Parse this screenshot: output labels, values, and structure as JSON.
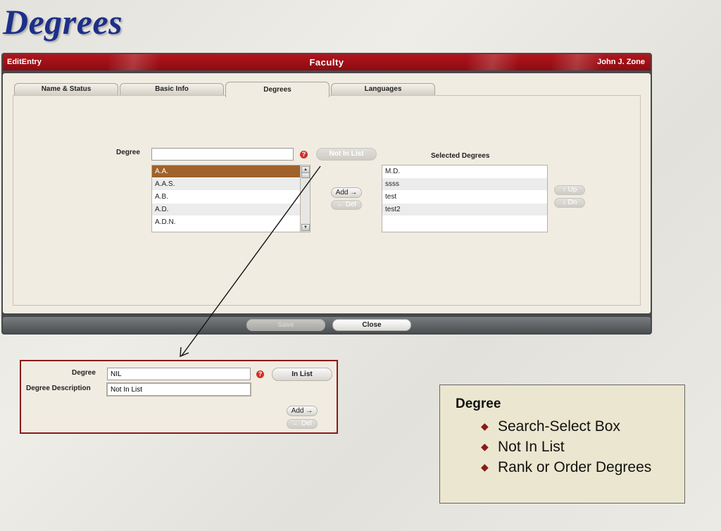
{
  "slide": {
    "title": "Degrees"
  },
  "window": {
    "left_label": "EditEntry",
    "title": "Faculty",
    "user": "John J. Zone"
  },
  "tabs": [
    {
      "label": "Name & Status"
    },
    {
      "label": "Basic Info"
    },
    {
      "label": "Degrees",
      "active": true
    },
    {
      "label": "Languages"
    }
  ],
  "degree_form": {
    "label": "Degree",
    "value": "",
    "help_icon": "?",
    "not_in_list_label": "Not In List",
    "options": [
      "A.A.",
      "A.A.S.",
      "A.B.",
      "A.D.",
      "A.D.N."
    ],
    "selected_option": "A.A."
  },
  "transfer": {
    "add_label": "Add →",
    "del_label": "← Del"
  },
  "selected_degrees": {
    "heading": "Selected Degrees",
    "items": [
      "M.D.",
      "ssss",
      "test",
      "test2"
    ],
    "up_label": "↑ Up",
    "down_label": "↓ Dn"
  },
  "footer": {
    "save_label": "Save",
    "close_label": "Close"
  },
  "zoom_panel": {
    "degree_label": "Degree",
    "degree_value": "NIL",
    "description_label": "Degree Description",
    "description_value": "Not In List",
    "in_list_label": "In List",
    "add_label": "Add →",
    "del_label": "← Del"
  },
  "info_box": {
    "heading": "Degree",
    "bullets": [
      "Search-Select Box",
      "Not In List",
      "Rank or Order Degrees"
    ]
  },
  "colors": {
    "title_bar": "#b3141c",
    "selected_row": "#a0622a",
    "frame": "#8b1a1a"
  }
}
